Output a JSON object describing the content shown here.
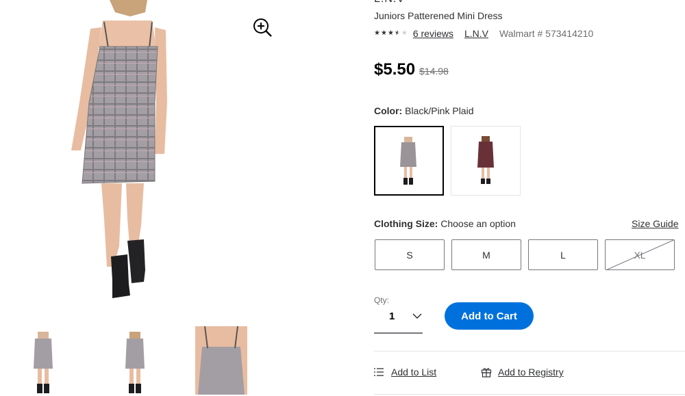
{
  "product": {
    "brand_top": "L.N.V",
    "title": "Juniors Patterened Mini Dress",
    "rating": {
      "stars": 3.5,
      "max_stars": 5,
      "reviews_label": "6 reviews"
    },
    "brand_link": "L.N.V",
    "sku_label": "Walmart # 573414210",
    "price": "$5.50",
    "was_price": "$14.98"
  },
  "color": {
    "label": "Color:",
    "value": "Black/Pink Plaid",
    "swatches": [
      {
        "name": "Black/Pink Plaid",
        "selected": true,
        "color": "#9a9499"
      },
      {
        "name": "Red Plaid",
        "selected": false,
        "color": "#6a3038"
      }
    ]
  },
  "size": {
    "label": "Clothing Size:",
    "placeholder": "Choose an option",
    "guide_label": "Size Guide",
    "options": [
      {
        "label": "S",
        "available": true
      },
      {
        "label": "M",
        "available": true
      },
      {
        "label": "L",
        "available": true
      },
      {
        "label": "XL",
        "available": false
      }
    ]
  },
  "quantity": {
    "label": "Qty:",
    "value": "1"
  },
  "actions": {
    "add_to_cart": "Add to Cart",
    "add_to_list": "Add to List",
    "add_to_registry": "Add to Registry"
  },
  "icons": {
    "zoom": "zoom-in-icon",
    "chevron": "chevron-down-icon",
    "list": "list-icon",
    "gift": "gift-icon"
  },
  "colors": {
    "accent": "#0071dc",
    "text": "#2e2f32",
    "muted": "#6d6e71",
    "dress": "#9a9499"
  }
}
